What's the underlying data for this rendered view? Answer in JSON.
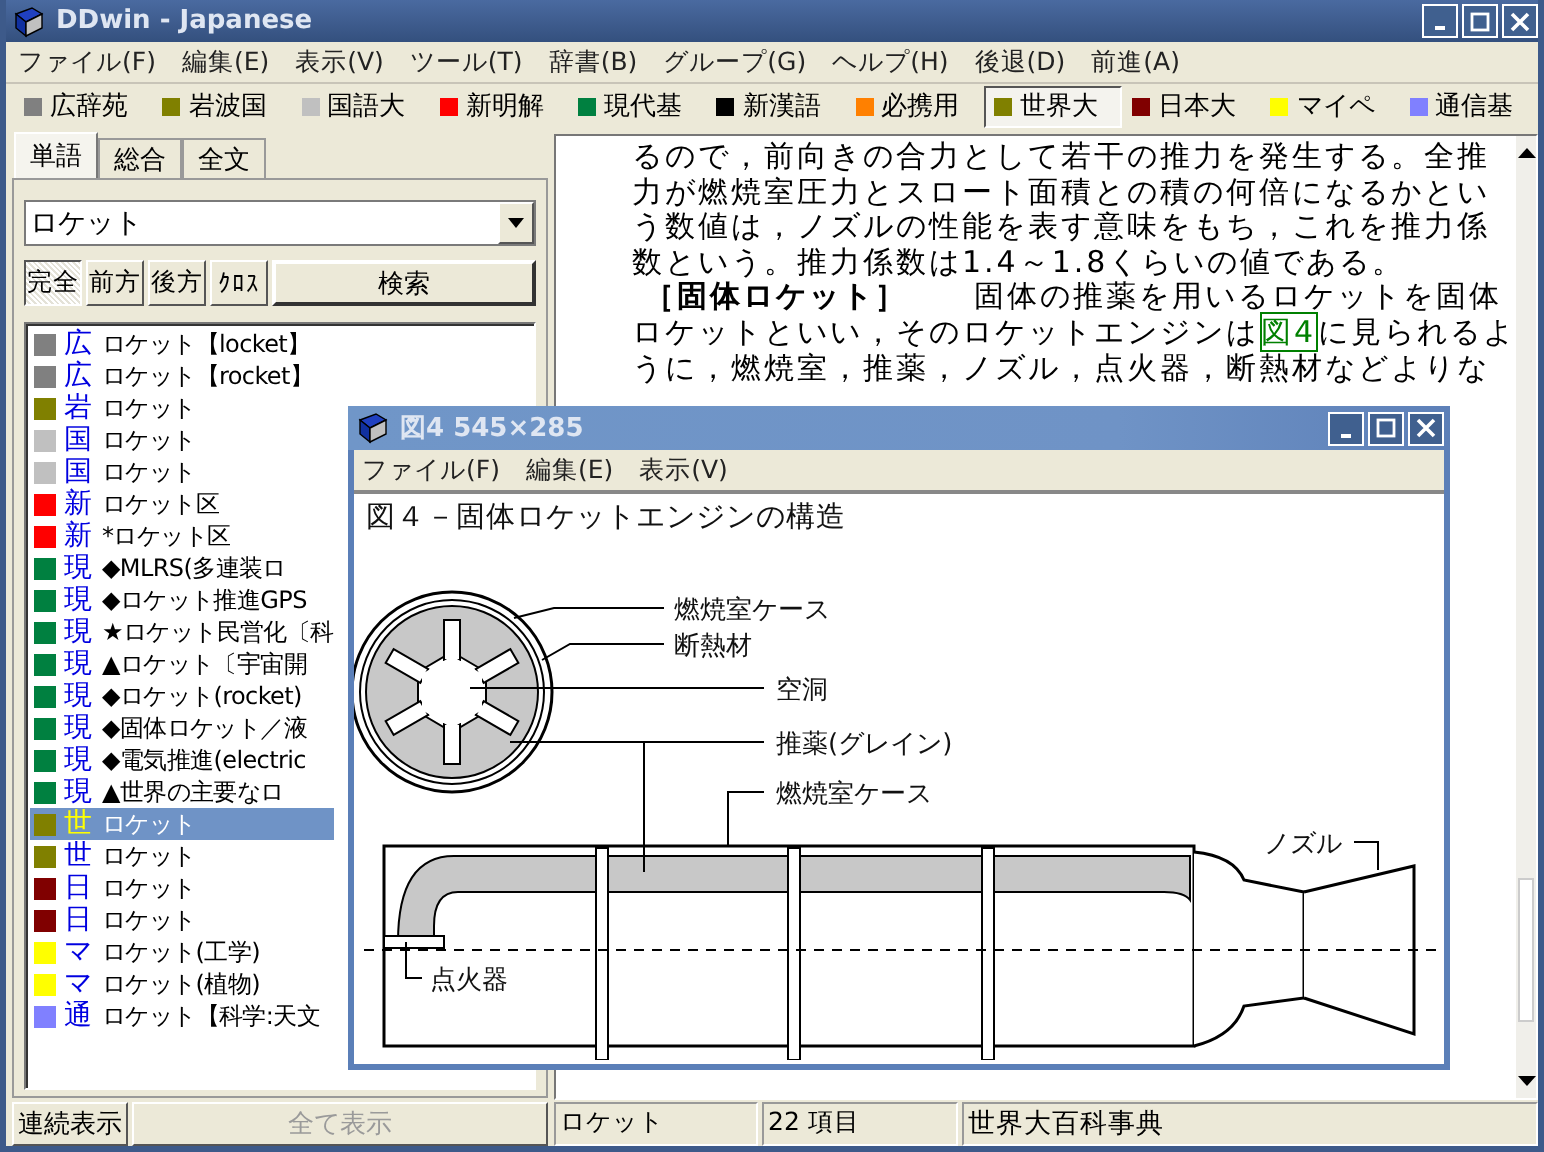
{
  "window": {
    "title": "DDwin - Japanese"
  },
  "menu": [
    "ファイル(F)",
    "編集(E)",
    "表示(V)",
    "ツール(T)",
    "辞書(B)",
    "グループ(G)",
    "ヘルプ(H)",
    "後退(D)",
    "前進(A)"
  ],
  "dictionaries": [
    {
      "label": "広辞苑",
      "color": "#808080",
      "selected": false
    },
    {
      "label": "岩波国",
      "color": "#808000",
      "selected": false
    },
    {
      "label": "国語大",
      "color": "#c0c0c0",
      "selected": false
    },
    {
      "label": "新明解",
      "color": "#ff0000",
      "selected": false
    },
    {
      "label": "現代基",
      "color": "#008040",
      "selected": false
    },
    {
      "label": "新漢語",
      "color": "#000000",
      "selected": false
    },
    {
      "label": "必携用",
      "color": "#ff8000",
      "selected": false
    },
    {
      "label": "世界大",
      "color": "#808000",
      "selected": true
    },
    {
      "label": "日本大",
      "color": "#800000",
      "selected": false
    },
    {
      "label": "マイペ",
      "color": "#ffff00",
      "selected": false
    },
    {
      "label": "通信基",
      "color": "#8080ff",
      "selected": false
    }
  ],
  "left_panel": {
    "tabs": [
      {
        "label": "単語",
        "selected": true
      },
      {
        "label": "総合",
        "selected": false
      },
      {
        "label": "全文",
        "selected": false
      }
    ],
    "search": {
      "value": "ロケット"
    },
    "modes": [
      {
        "label": "完全",
        "selected": true
      },
      {
        "label": "前方",
        "selected": false
      },
      {
        "label": "後方",
        "selected": false
      },
      {
        "label": "ｸﾛｽ",
        "selected": false
      }
    ],
    "search_button": "検索",
    "results": [
      {
        "abbr": "広",
        "color": "#808080",
        "text": "ロケット【locket】",
        "selected": false
      },
      {
        "abbr": "広",
        "color": "#808080",
        "text": "ロケット【rocket】",
        "selected": false
      },
      {
        "abbr": "岩",
        "color": "#808000",
        "text": "ロケット",
        "selected": false
      },
      {
        "abbr": "国",
        "color": "#c0c0c0",
        "text": "ロケット",
        "selected": false
      },
      {
        "abbr": "国",
        "color": "#c0c0c0",
        "text": "ロケット",
        "selected": false
      },
      {
        "abbr": "新",
        "color": "#ff0000",
        "text": "ロケット区",
        "selected": false
      },
      {
        "abbr": "新",
        "color": "#ff0000",
        "text": "*ロケット区",
        "selected": false
      },
      {
        "abbr": "現",
        "color": "#008040",
        "text": "◆MLRS(多連装ロ",
        "selected": false
      },
      {
        "abbr": "現",
        "color": "#008040",
        "text": "◆ロケット推進GPS",
        "selected": false
      },
      {
        "abbr": "現",
        "color": "#008040",
        "text": "★ロケット民営化〔科",
        "selected": false
      },
      {
        "abbr": "現",
        "color": "#008040",
        "text": "▲ロケット〔宇宙開",
        "selected": false
      },
      {
        "abbr": "現",
        "color": "#008040",
        "text": "◆ロケット(rocket)",
        "selected": false
      },
      {
        "abbr": "現",
        "color": "#008040",
        "text": "◆固体ロケット／液",
        "selected": false
      },
      {
        "abbr": "現",
        "color": "#008040",
        "text": "◆電気推進(electric",
        "selected": false
      },
      {
        "abbr": "現",
        "color": "#008040",
        "text": "▲世界の主要なロ",
        "selected": false
      },
      {
        "abbr": "世",
        "color": "#808000",
        "text": "ロケット",
        "selected": true
      },
      {
        "abbr": "世",
        "color": "#808000",
        "text": "ロケット",
        "selected": false
      },
      {
        "abbr": "日",
        "color": "#800000",
        "text": "ロケット",
        "selected": false
      },
      {
        "abbr": "日",
        "color": "#800000",
        "text": "ロケット",
        "selected": false
      },
      {
        "abbr": "マ",
        "color": "#ffff00",
        "text": "ロケット(工学)",
        "selected": false
      },
      {
        "abbr": "マ",
        "color": "#ffff00",
        "text": "ロケット(植物)",
        "selected": false
      },
      {
        "abbr": "通",
        "color": "#8080ff",
        "text": "ロケット【科学:天文",
        "selected": false
      }
    ],
    "buttons": [
      {
        "label": "連続表示",
        "disabled": false
      },
      {
        "label": "全て表示",
        "disabled": true
      }
    ]
  },
  "article": {
    "lines": [
      {
        "kind": "text",
        "text": "るので，前向きの合力として若干の推力を発生する。全推"
      },
      {
        "kind": "text",
        "text": "力が燃焼室圧力とスロート面積との積の何倍になるかとい"
      },
      {
        "kind": "text",
        "text": "う数値は，ノズルの性能を表す意味をもち，これを推力係"
      },
      {
        "kind": "text",
        "text": "数という。推力係数は1.4～1.8くらいの値である。"
      },
      {
        "kind": "heading",
        "heading": "［固体ロケット］",
        "text": "　　固体の推薬を用いるロケットを固体"
      },
      {
        "kind": "link",
        "text_before": "ロケットといい，そのロケットエンジンは",
        "link": "図4",
        "text_after": "に見られるよ"
      },
      {
        "kind": "text",
        "text": "うに，燃焼室，推薬，ノズル，点火器，断熱材などよりな"
      }
    ]
  },
  "figure_window": {
    "title": "図4 545×285",
    "menu": [
      "ファイル(F)",
      "編集(E)",
      "表示(V)"
    ],
    "caption": "図４－固体ロケットエンジンの構造",
    "labels": [
      "燃焼室ケース",
      "断熱材",
      "空洞",
      "推薬(グレイン)",
      "燃焼室ケース",
      "ノズル",
      "点火器"
    ]
  },
  "status_bar": [
    "ロケット",
    "22 項目",
    "世界大百科事典"
  ]
}
